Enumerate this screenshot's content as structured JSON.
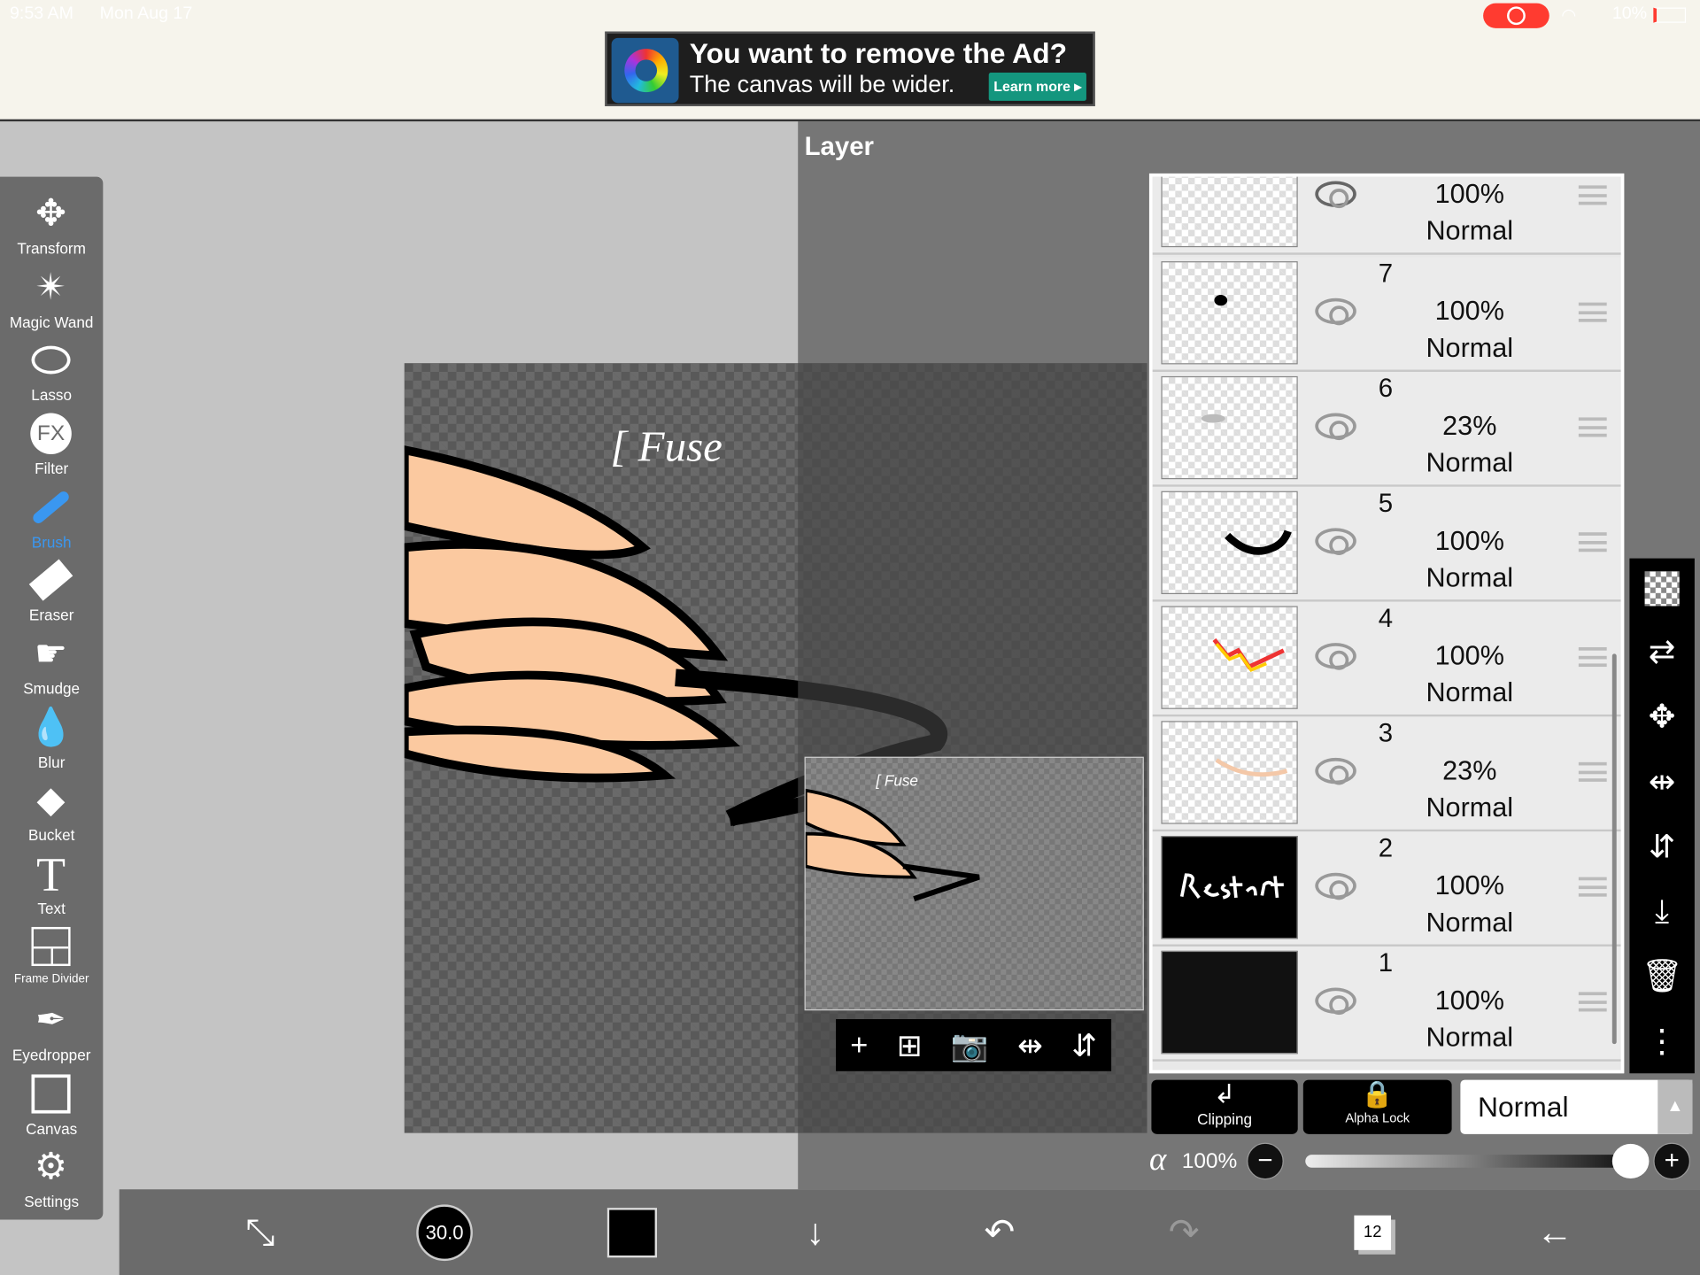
{
  "status_bar": {
    "time": "9:53 AM",
    "date": "Mon Aug 17",
    "battery": "10%"
  },
  "ad": {
    "headline": "You want to remove the Ad?",
    "subline": "The canvas will be wider.",
    "button": "Learn more ▸"
  },
  "tools": [
    {
      "label": "Transform",
      "icon": "move-arrows-icon"
    },
    {
      "label": "Magic Wand",
      "icon": "magic-wand-icon"
    },
    {
      "label": "Lasso",
      "icon": "lasso-icon"
    },
    {
      "label": "Filter",
      "icon": "fx-icon"
    },
    {
      "label": "Brush",
      "icon": "brush-icon",
      "active": true
    },
    {
      "label": "Eraser",
      "icon": "eraser-icon"
    },
    {
      "label": "Smudge",
      "icon": "smudge-icon"
    },
    {
      "label": "Blur",
      "icon": "droplet-icon"
    },
    {
      "label": "Bucket",
      "icon": "bucket-icon"
    },
    {
      "label": "Text",
      "icon": "text-icon"
    },
    {
      "label": "Frame Divider",
      "icon": "frame-divider-icon"
    },
    {
      "label": "Eyedropper",
      "icon": "eyedropper-icon"
    },
    {
      "label": "Canvas",
      "icon": "canvas-icon"
    },
    {
      "label": "Settings",
      "icon": "gear-icon"
    }
  ],
  "layer_panel": {
    "title": "Layer",
    "layers": [
      {
        "number": "",
        "opacity": "100%",
        "mode": "Normal"
      },
      {
        "number": "7",
        "opacity": "100%",
        "mode": "Normal"
      },
      {
        "number": "6",
        "opacity": "23%",
        "mode": "Normal"
      },
      {
        "number": "5",
        "opacity": "100%",
        "mode": "Normal"
      },
      {
        "number": "4",
        "opacity": "100%",
        "mode": "Normal"
      },
      {
        "number": "3",
        "opacity": "23%",
        "mode": "Normal"
      },
      {
        "number": "2",
        "opacity": "100%",
        "mode": "Normal"
      },
      {
        "number": "1",
        "opacity": "100%",
        "mode": "Normal"
      }
    ],
    "clipping_label": "Clipping",
    "alpha_lock_label": "Alpha Lock",
    "blend_mode": "Normal",
    "opacity_symbol": "α",
    "opacity_value": "100%",
    "opacity_fraction": 1.0
  },
  "bottom_bar": {
    "brush_size": "30.0",
    "layer_count": "12",
    "color": "#000000"
  },
  "colors": {
    "accent": "#3a97f0",
    "ad_button": "#14967e",
    "record": "#ff3b30"
  }
}
